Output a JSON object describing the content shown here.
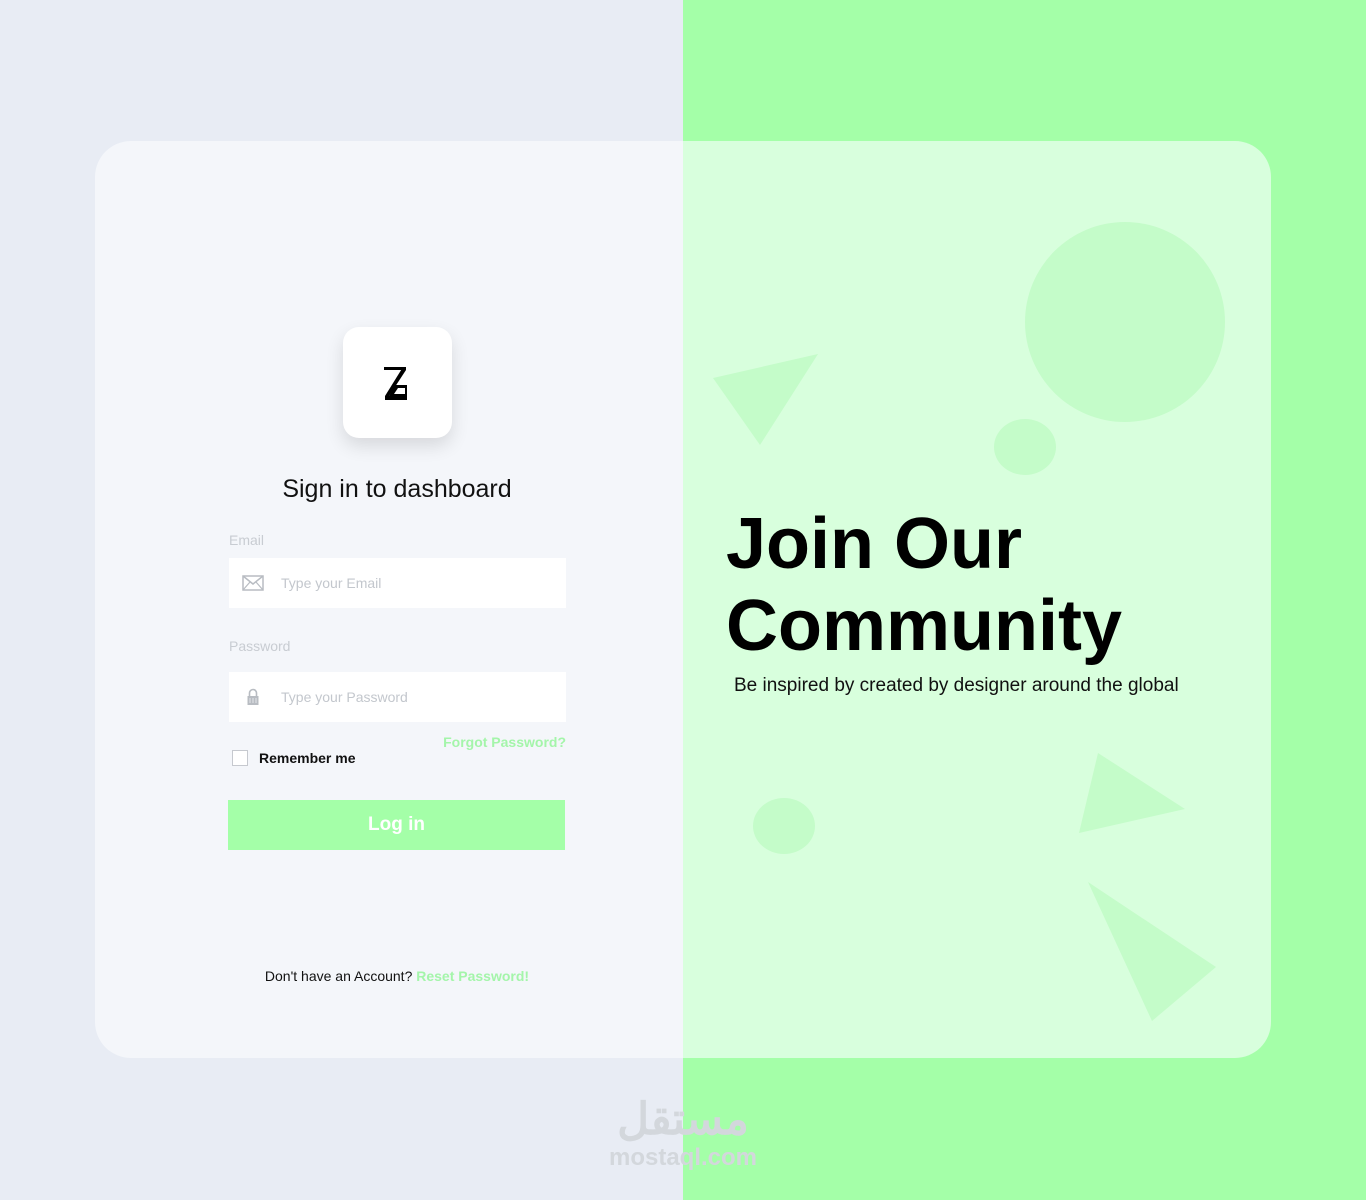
{
  "login": {
    "title": "Sign in to dashboard",
    "email_label": "Email",
    "email_placeholder": "Type your Email",
    "password_label": "Password",
    "password_placeholder": "Type your Password",
    "forgot_link": "Forgot Password?",
    "remember_label": "Remember me",
    "login_button": "Log in",
    "signup_prompt": "Don't have an Account?",
    "signup_link": "Reset Password!"
  },
  "hero": {
    "title": "Join Our Community",
    "subtitle": "Be inspired by created by designer around the global"
  },
  "watermark": {
    "arabic": "مستقل",
    "latin": "mostaql.com"
  },
  "colors": {
    "accent": "#a4ffa8",
    "left_bg": "#e8ecf4",
    "card_left": "#f4f6fa",
    "card_right": "#d8ffdd"
  },
  "icons": {
    "logo": "z-logo",
    "email": "envelope-icon",
    "password": "lock-icon"
  }
}
